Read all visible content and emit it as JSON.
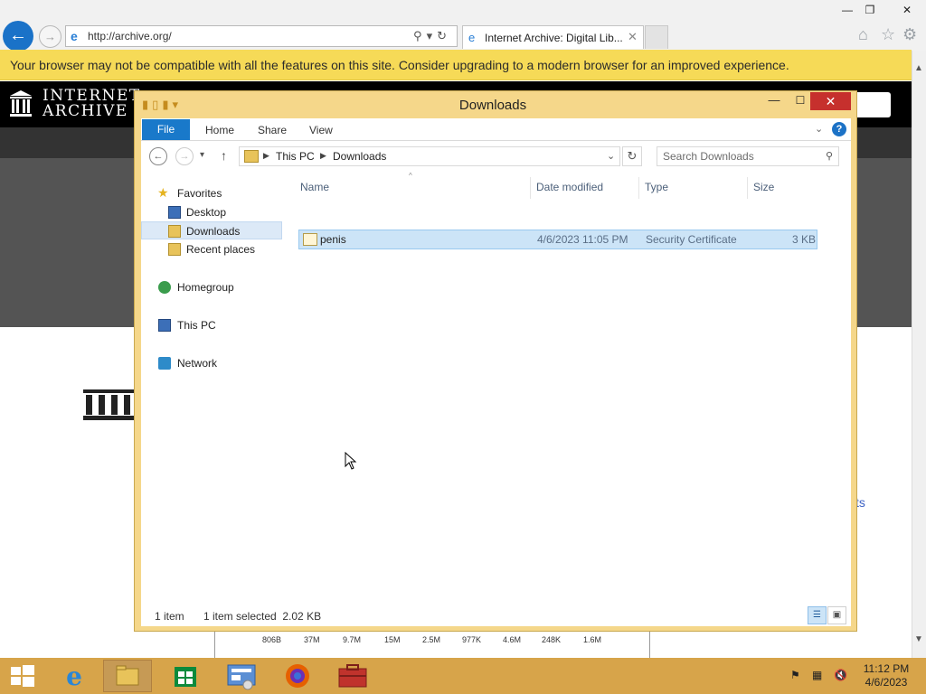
{
  "browser": {
    "url": "http://archive.org/",
    "tab_title": "Internet Archive: Digital Lib...",
    "tab_close": "✕",
    "compat_message": "Your browser may not be compatible with all the features on this site. Consider upgrading to a modern browser for an improved experience."
  },
  "page": {
    "logo_line1": "INTERNET",
    "logo_line2": "ARCHIVE",
    "link_fragment": "ts",
    "stats": [
      "806B",
      "37M",
      "9.7M",
      "15M",
      "2.5M",
      "977K",
      "4.6M",
      "248K",
      "1.6M"
    ]
  },
  "explorer": {
    "title": "Downloads",
    "ribbon_tabs": [
      "File",
      "Home",
      "Share",
      "View"
    ],
    "path": [
      "This PC",
      "Downloads"
    ],
    "search_placeholder": "Search Downloads",
    "nav": {
      "favorites": "Favorites",
      "desktop": "Desktop",
      "downloads": "Downloads",
      "recent": "Recent places",
      "homegroup": "Homegroup",
      "thispc": "This PC",
      "network": "Network"
    },
    "columns": {
      "name": "Name",
      "date": "Date modified",
      "type": "Type",
      "size": "Size"
    },
    "files": [
      {
        "name": "penis",
        "date": "4/6/2023 11:05 PM",
        "type": "Security Certificate",
        "size": "3 KB"
      }
    ],
    "status": {
      "count": "1 item",
      "selected": "1 item selected  2.02 KB"
    }
  },
  "taskbar": {
    "time": "11:12 PM",
    "date": "4/6/2023"
  },
  "colors": {
    "window_frame": "#f5d78a",
    "taskbar": "#d7a44a",
    "compat_bar": "#f6da57",
    "selection": "#cce4f7",
    "accent": "#1979ca"
  }
}
